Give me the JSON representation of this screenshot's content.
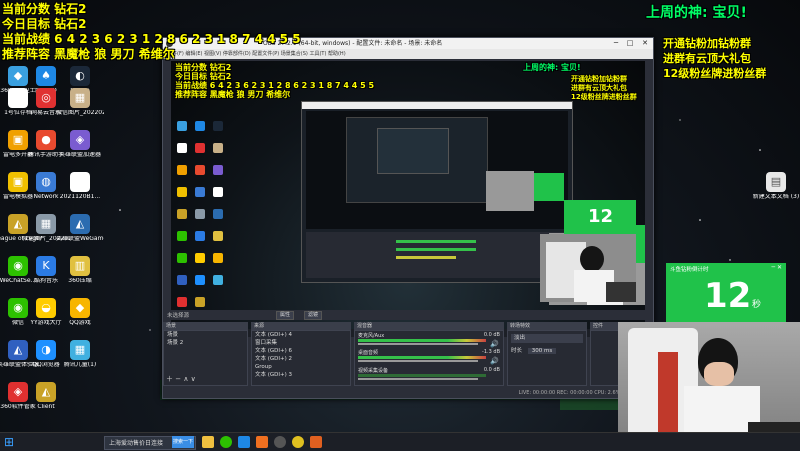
{
  "overlay": {
    "line1": "当前分数 钻石2",
    "line2": "今日目标 钻石2",
    "line3": "当前战绩 6 4 2 3 6 2 3 1 2 8 6 2 3 1 8 7 4 4 5 5",
    "line4": "推荐阵容 黑魔枪 狼 男刀 希维尔",
    "top_right": "上周的神: 宝贝!",
    "right1": "开通钻粉加钻粉群",
    "right2": "进群有云顶大礼包",
    "right3": "12级粉丝牌进粉丝群"
  },
  "desktop_icons": [
    {
      "label": "360安全卫士",
      "glyph": "◆",
      "color": "#3aa0e0"
    },
    {
      "label": "腾讯QQ",
      "glyph": "♠",
      "color": "#1e88e5"
    },
    {
      "label": "Steam",
      "glyph": "◐",
      "color": "#1b2838"
    },
    {
      "label": "1号位存档",
      "glyph": "▮",
      "color": "#ffffff"
    },
    {
      "label": "网易云音乐",
      "glyph": "◎",
      "color": "#e03131"
    },
    {
      "label": "微信图片_2022021...",
      "glyph": "▦",
      "color": "#c8b088"
    },
    {
      "label": "雷电多开器",
      "glyph": "▣",
      "color": "#f0a000"
    },
    {
      "label": "腾讯手游助手",
      "glyph": "●",
      "color": "#e84a2f"
    },
    {
      "label": "英雄联盟加速器",
      "glyph": "◈",
      "color": "#7a5cd0"
    },
    {
      "label": "雷电模拟器",
      "glyph": "▣",
      "color": "#f0c000"
    },
    {
      "label": "Network",
      "glyph": "◍",
      "color": "#3a7bd5"
    },
    {
      "label": "2021120B1...",
      "glyph": "▤",
      "color": "#ffffff"
    },
    {
      "label": "League of Legends",
      "glyph": "◭",
      "color": "#c9a227"
    },
    {
      "label": "微信图片_2022021...",
      "glyph": "▦",
      "color": "#8a9aa8"
    },
    {
      "label": "英雄联盟WeGame版",
      "glyph": "◭",
      "color": "#2b6cb0"
    },
    {
      "label": "WeChatSe...",
      "glyph": "◉",
      "color": "#2dc100"
    },
    {
      "label": "酷狗音乐",
      "glyph": "K",
      "color": "#2b7be4"
    },
    {
      "label": "360压缩",
      "glyph": "▥",
      "color": "#e0c040"
    },
    {
      "label": "微信",
      "glyph": "◉",
      "color": "#2dc100"
    },
    {
      "label": "YY游戏大厅",
      "glyph": "◒",
      "color": "#ffcc00"
    },
    {
      "label": "QQ游戏",
      "glyph": "◆",
      "color": "#f7b500"
    },
    {
      "label": "英雄联盟体验服",
      "glyph": "◭",
      "color": "#3060c0"
    },
    {
      "label": "QQ浏览器",
      "glyph": "◑",
      "color": "#1e90ff"
    },
    {
      "label": "腾讯儿童(1)",
      "glyph": "▦",
      "color": "#40b0e0"
    },
    {
      "label": "360软件管家",
      "glyph": "◈",
      "color": "#e03030"
    },
    {
      "label": "Client",
      "glyph": "◭",
      "color": "#c9a227"
    }
  ],
  "right_desktop_icon": {
    "label": "新建文本文档 (3)",
    "glyph": "▤"
  },
  "obs": {
    "title": "OBS 27.2.1 (64-bit, windows) - 配置文件: 未命名 - 场景: 未命名",
    "menu": "文件(F)   编辑(E)   视图(V)   停靠部件(D)   配置文件(P)   场景集合(S)   工具(T)   帮助(H)",
    "no_source_label": "未选择源",
    "props_btn": "属性",
    "filter_btn": "滤镜",
    "docks": {
      "scenes": "场景",
      "sources": "来源",
      "mixer": "混音器",
      "transitions": "转场特效",
      "controls": "控件"
    },
    "scenes_list": [
      "场景",
      "场景 2"
    ],
    "sources_list": [
      "文本 (GDI+) 4",
      "窗口采集",
      "文本 (GDI+) 6",
      "文本 (GDI+) 2",
      "Group",
      "文本 (GDI+) 3"
    ],
    "mixer_tracks": [
      {
        "name": "麦克风/Aux",
        "db": "0.0 dB"
      },
      {
        "name": "桌面音频",
        "db": "-1.3 dB"
      },
      {
        "name": "视频采集设备",
        "db": "0.0 dB"
      }
    ],
    "transition_value": "淡出",
    "duration_label": "时长",
    "duration_value": "300 ms",
    "controls": [
      "开始推流",
      "开始录制",
      "启动虚拟摄像机",
      "工作室模式",
      "设置",
      "退出"
    ],
    "status": "LIVE: 00:00:00   REC: 00:00:00   CPU: 2.6%, 60.00 fps"
  },
  "widget": {
    "value": "12",
    "suffix": "秒",
    "title": "斗鱼钻粉倒计时"
  },
  "taskbar": {
    "search_text": "上海爱动售价日连接",
    "search_btn": "搜索一下"
  },
  "colors": {
    "overlay_yellow": "#ffff00",
    "overlay_green": "#00ff66",
    "overlay_white": "#ffffff",
    "widget_green": "#20c24a"
  }
}
